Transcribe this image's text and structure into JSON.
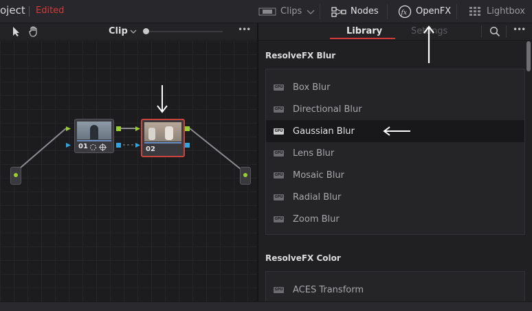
{
  "header": {
    "project_title": "oject",
    "edited_label": "Edited",
    "clips_label": "Clips",
    "nodes_label": "Nodes",
    "openfx_label": "OpenFX",
    "lightbox_label": "Lightbox"
  },
  "node_toolbar": {
    "clip_label": "Clip",
    "more_label": "•••"
  },
  "panel_tabs": {
    "library_label": "Library",
    "settings_label": "Settings",
    "more_label": "•••"
  },
  "nodes": [
    {
      "label": "01"
    },
    {
      "label": "02"
    }
  ],
  "library": {
    "categories": [
      {
        "title": "ResolveFX Blur",
        "items": [
          "Box Blur",
          "Directional Blur",
          "Gaussian Blur",
          "Lens Blur",
          "Mosaic Blur",
          "Radial Blur",
          "Zoom Blur"
        ],
        "selected": "Gaussian Blur"
      },
      {
        "title": "ResolveFX Color",
        "items": [
          "ACES Transform"
        ]
      }
    ],
    "gpu_badge": "GPU"
  },
  "colors": {
    "accent_red": "#d23a3a",
    "node_selected_border": "#c8443c",
    "connector_green": "#9acd32",
    "connector_blue": "#33a3e0"
  }
}
